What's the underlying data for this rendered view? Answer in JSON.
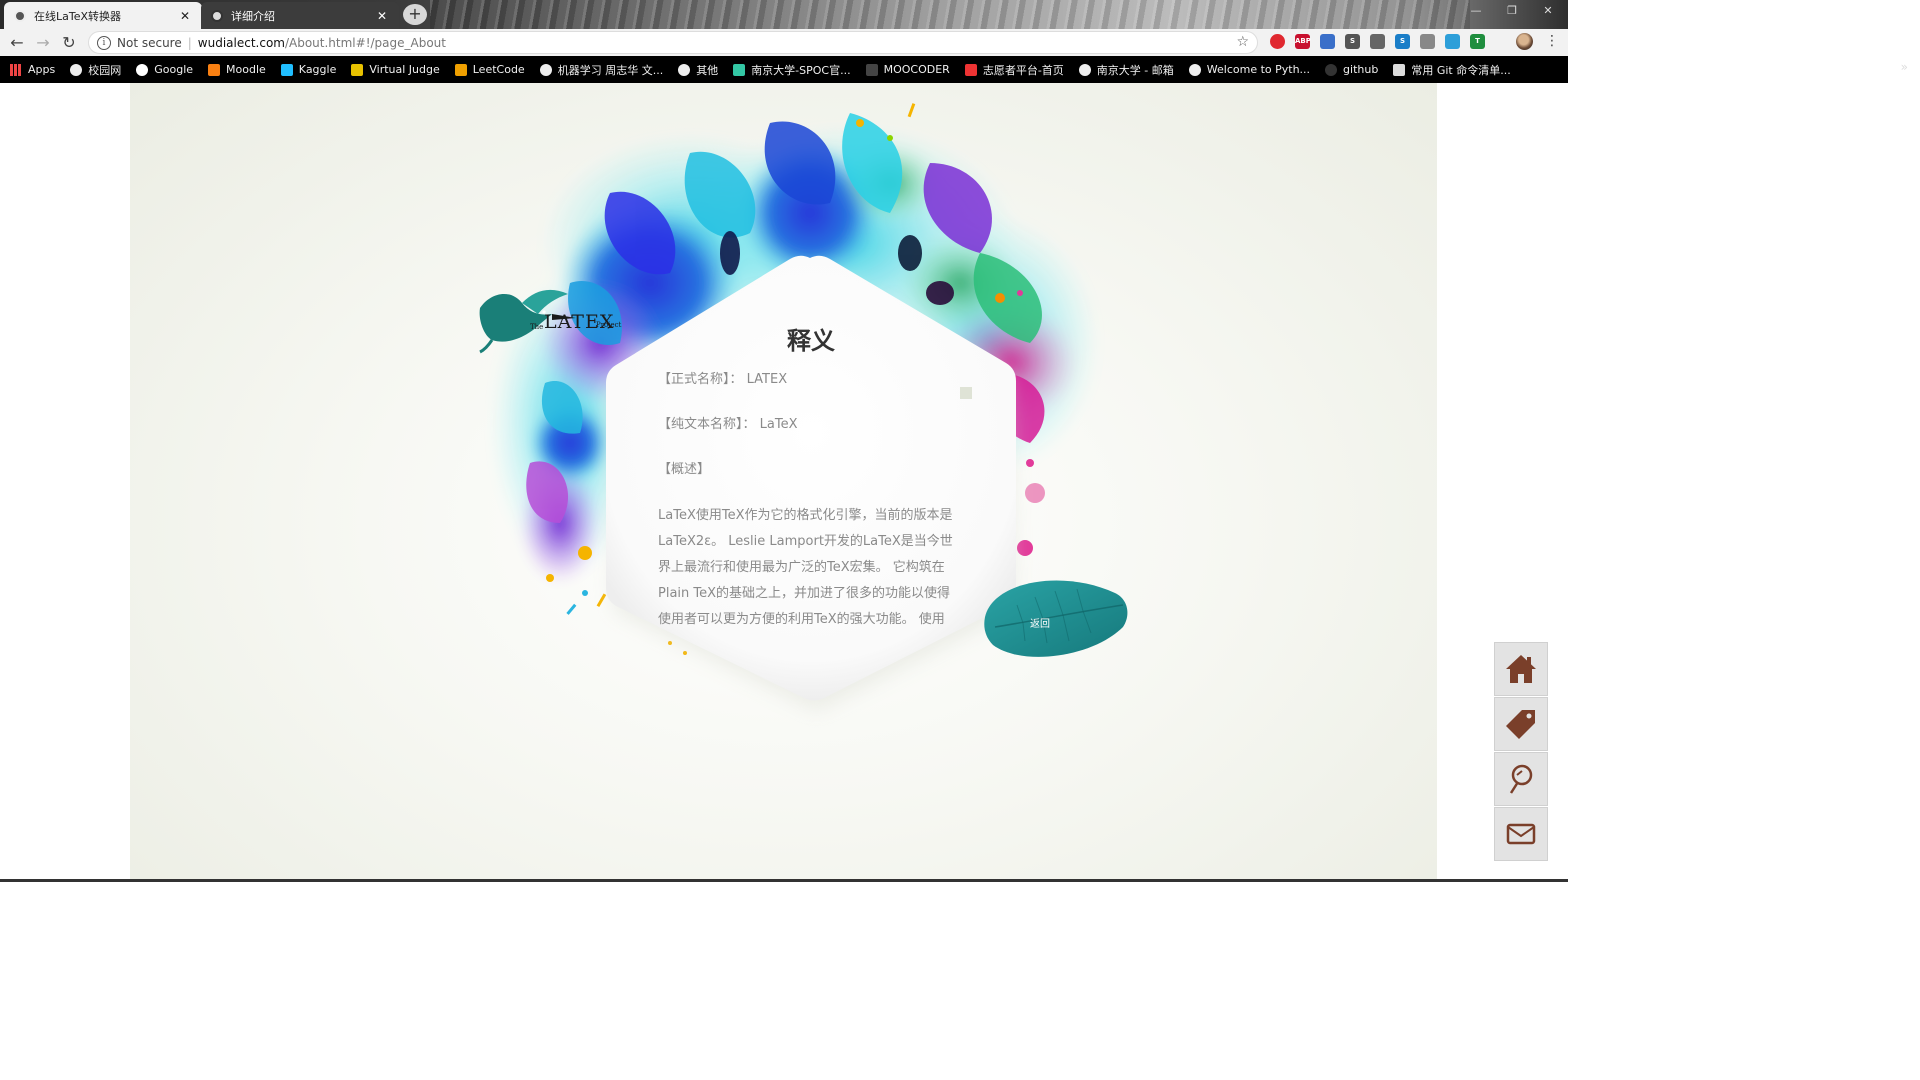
{
  "browser": {
    "tabs": [
      {
        "title": "在线LaTeX转换器",
        "active": true
      },
      {
        "title": "详细介绍",
        "active": false
      }
    ],
    "address": {
      "security": "Not secure",
      "host": "wudialect.com",
      "path": "/About.html#!/page_About"
    },
    "bookmarks": [
      {
        "label": "Apps",
        "icon": "apps-grid-icon"
      },
      {
        "label": "校园网",
        "icon": "globe-icon"
      },
      {
        "label": "Google",
        "icon": "google-icon"
      },
      {
        "label": "Moodle",
        "icon": "moodle-icon"
      },
      {
        "label": "Kaggle",
        "icon": "kaggle-icon"
      },
      {
        "label": "Virtual Judge",
        "icon": "vjudge-icon"
      },
      {
        "label": "LeetCode",
        "icon": "leetcode-icon"
      },
      {
        "label": "机器学习 周志华 文...",
        "icon": "globe-icon"
      },
      {
        "label": "其他",
        "icon": "globe-icon"
      },
      {
        "label": "南京大学-SPOC官...",
        "icon": "nju-icon"
      },
      {
        "label": "MOOCODER",
        "icon": "moocoder-icon"
      },
      {
        "label": "志愿者平台-首页",
        "icon": "volunteer-icon"
      },
      {
        "label": "南京大学 - 邮箱",
        "icon": "globe-icon"
      },
      {
        "label": "Welcome to Pyth...",
        "icon": "globe-icon"
      },
      {
        "label": "github",
        "icon": "github-icon"
      },
      {
        "label": "常用 Git 命令清单...",
        "icon": "doc-icon"
      }
    ],
    "more_bookmarks": "»"
  },
  "logo": {
    "small_left": "The",
    "main": "LATEX",
    "small_right": "Project"
  },
  "card": {
    "title": "释义",
    "formal_name": "【正式名称】： LATEX",
    "plain_name": "【纯文本名称】： LaTeX",
    "overview_heading": "【概述】",
    "overview_text": "LaTeX使用TeX作为它的格式化引擎，当前的版本是LaTeX2ε。 Leslie Lamport开发的LaTeX是当今世界上最流行和使用最为广泛的TeX宏集。 它构筑在Plain TeX的基础之上，并加进了很多的功能以使得使用者可以更为方便的利用TeX的强大功能。 使用"
  },
  "back_button": "返回",
  "sidenav": [
    "home-icon",
    "tag-icon",
    "pin-icon",
    "mail-icon"
  ],
  "colors": {
    "leaf": "#1f8a8c",
    "sidenav_icon": "#7a3f2a",
    "card_text": "#8a8a8a"
  }
}
